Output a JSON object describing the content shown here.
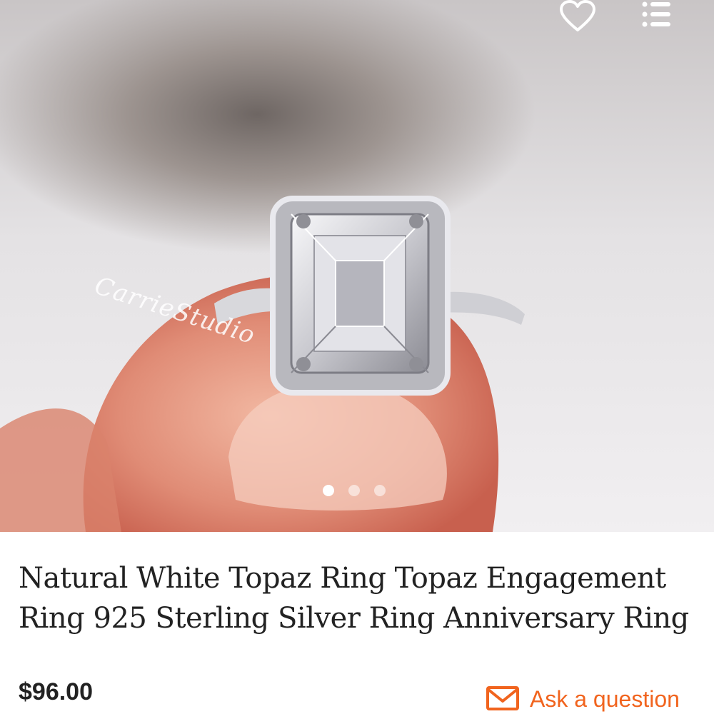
{
  "colors": {
    "accent": "#f1641e",
    "text": "#222222",
    "white": "#ffffff"
  },
  "header": {
    "favorite_icon": "heart-icon",
    "menu_icon": "menu-list-icon"
  },
  "gallery": {
    "watermark": "CarrieStudio",
    "image_count": 3,
    "active_index": 0
  },
  "listing": {
    "title": "Natural White Topaz Ring Topaz Engagement Ring 925 Sterling Silver Ring Anniversary Ring",
    "price": "$96.00"
  },
  "contact": {
    "ask_label": "Ask a question",
    "icon": "envelope-icon"
  }
}
